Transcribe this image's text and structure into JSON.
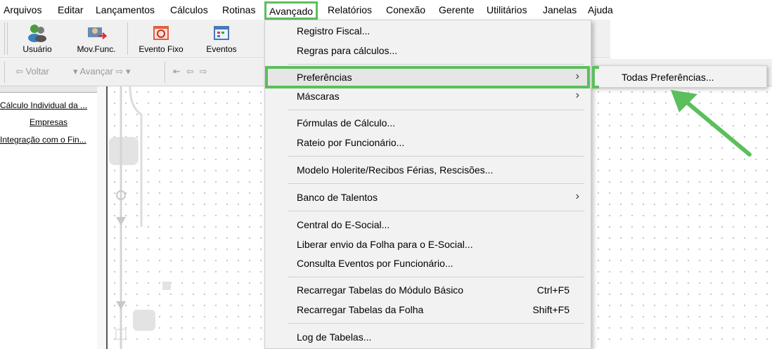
{
  "menubar": {
    "items": [
      "Arquivos",
      "Editar",
      "Lançamentos",
      "Cálculos",
      "Rotinas",
      "Avançado",
      "Relatórios",
      "Conexão",
      "Gerente",
      "Utilitários",
      "Janelas",
      "Ajuda"
    ]
  },
  "toolbar": {
    "buttons": [
      {
        "label": "Usuário",
        "icon": "users-icon"
      },
      {
        "label": "Mov.Func.",
        "icon": "employee-movement-icon"
      },
      {
        "label": "Evento Fixo",
        "icon": "fixed-event-icon"
      },
      {
        "label": "Eventos",
        "icon": "events-calendar-icon"
      }
    ],
    "nav": {
      "back": "Voltar",
      "forward": "Avançar"
    }
  },
  "left_panel": {
    "links": [
      "Cálculo Individual da ...",
      "Empresas",
      "Integração com o Fin..."
    ]
  },
  "dropdown": {
    "items": [
      {
        "label": "Registro Fiscal..."
      },
      {
        "label": "Regras para cálculos..."
      },
      {
        "label": "Preferências",
        "submenu": true
      },
      {
        "label": "Máscaras",
        "submenu": true
      },
      {
        "label": "Fórmulas de Cálculo..."
      },
      {
        "label": "Rateio por Funcionário..."
      },
      {
        "label": "Modelo Holerite/Recibos Férias, Rescisões..."
      },
      {
        "label": "Banco de Talentos",
        "submenu": true
      },
      {
        "label": "Central do E-Social..."
      },
      {
        "label": "Liberar envio da Folha para o E-Social..."
      },
      {
        "label": "Consulta Eventos por Funcionário..."
      },
      {
        "label": "Recarregar Tabelas do Módulo Básico",
        "shortcut": "Ctrl+F5"
      },
      {
        "label": "Recarregar Tabelas da Folha",
        "shortcut": "Shift+F5"
      },
      {
        "label": "Log de Tabelas..."
      }
    ]
  },
  "submenu": {
    "items": [
      {
        "label": "Todas Preferências..."
      }
    ]
  },
  "colors": {
    "highlight": "#5bbf5b",
    "menu_bg": "#f2f2f2",
    "toolbar_bg": "#f0f0f0"
  }
}
